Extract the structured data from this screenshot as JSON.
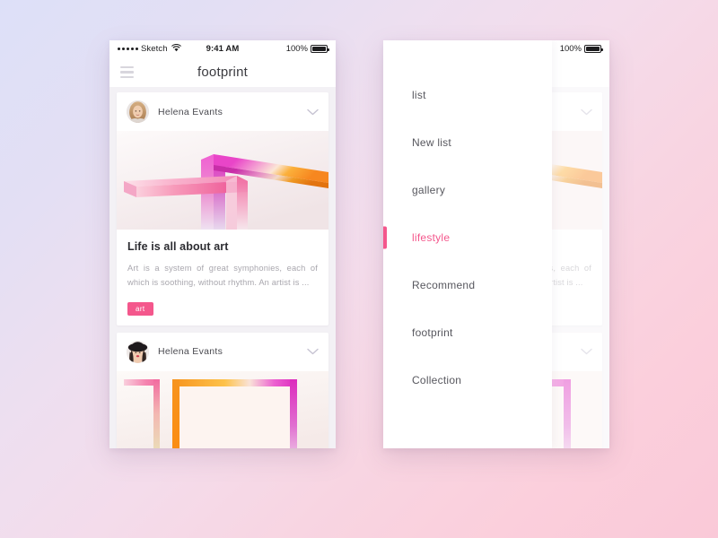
{
  "background": {
    "top_left_color": "#dde0f8",
    "bottom_right_color": "#fac9d8"
  },
  "accent_color": "#f4578c",
  "status_bar": {
    "carrier": "Sketch",
    "time": "9:41 AM",
    "battery_text": "100%",
    "signal_dots": 5,
    "wifi_icon": "wifi-icon",
    "battery_icon": "battery-icon"
  },
  "navbar": {
    "menu_icon": "hamburger-icon",
    "title": "footprint"
  },
  "cards": [
    {
      "author": "Helena Evants",
      "avatar_icon": "avatar-blonde-woman",
      "chevron_icon": "chevron-down-icon",
      "artwork_name": "abstract-3d-bars-pink-orange",
      "title": "Life is all about art",
      "excerpt": "Art is a system of great symphonies, each of which is soothing, without rhythm. An artist is ...",
      "tag": "art"
    },
    {
      "author": "Helena Evants",
      "avatar_icon": "avatar-woman-black-hat",
      "chevron_icon": "chevron-down-icon",
      "artwork_name": "abstract-3d-frame-orange-magenta"
    }
  ],
  "drawer": {
    "items": [
      {
        "label": "list",
        "active": false
      },
      {
        "label": "New list",
        "active": false
      },
      {
        "label": "gallery",
        "active": false
      },
      {
        "label": "lifestyle",
        "active": true
      },
      {
        "label": "Recommend",
        "active": false
      },
      {
        "label": "footprint",
        "active": false
      },
      {
        "label": "Collection",
        "active": false
      }
    ]
  }
}
